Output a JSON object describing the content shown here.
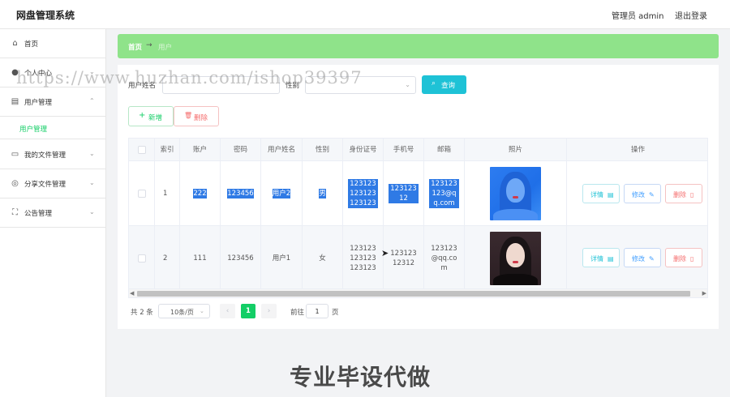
{
  "header": {
    "app_title": "网盘管理系统",
    "user_label": "管理员 admin",
    "logout_label": "退出登录"
  },
  "sidebar": {
    "items": [
      {
        "label": "首页",
        "icon": "home-icon"
      },
      {
        "label": "个人中心",
        "icon": "user-icon"
      },
      {
        "label": "用户管理",
        "icon": "chart-icon"
      },
      {
        "label": "我的文件管理",
        "icon": "message-icon"
      },
      {
        "label": "分享文件管理",
        "icon": "compass-icon"
      },
      {
        "label": "公告管理",
        "icon": "fullscreen-icon"
      }
    ],
    "subitem": "用户管理"
  },
  "breadcrumb": {
    "home": "首页",
    "arrow": "→",
    "current": "用户"
  },
  "search": {
    "name_label": "用户姓名",
    "name_value": "",
    "gender_label": "性别",
    "query_label": "查询"
  },
  "actions": {
    "add_label": "新增",
    "delete_label": "删除"
  },
  "table": {
    "headers": [
      "索引",
      "账户",
      "密码",
      "用户姓名",
      "性别",
      "身份证号",
      "手机号",
      "邮箱",
      "照片",
      "操作"
    ],
    "rows": [
      {
        "index": "1",
        "account": "222",
        "password": "123456",
        "name": "用户2",
        "gender": "男",
        "id_card": "123123123123123123",
        "phone": "12312312",
        "email": "123123123@qq.com"
      },
      {
        "index": "2",
        "account": "111",
        "password": "123456",
        "name": "用户1",
        "gender": "女",
        "id_card": "123123123123123123",
        "phone": "12312312312",
        "email": "123123@qq.com"
      }
    ],
    "op_detail": "详情",
    "op_edit": "修改",
    "op_delete": "删除"
  },
  "pagination": {
    "total": "共 2 条",
    "page_size": "10条/页",
    "current_page": "1",
    "goto_label": "前往",
    "goto_value": "1",
    "page_suffix": "页"
  },
  "overlay": {
    "watermark": "https://www.huzhan.com/ishop39397",
    "banner": "专业毕设代做"
  },
  "colors": {
    "accent": "#13ce66",
    "breadcrumb_bg": "#8fe38a",
    "query_button": "#1ec2d6",
    "selection": "#2f7ae5",
    "danger": "#f56c6c"
  }
}
